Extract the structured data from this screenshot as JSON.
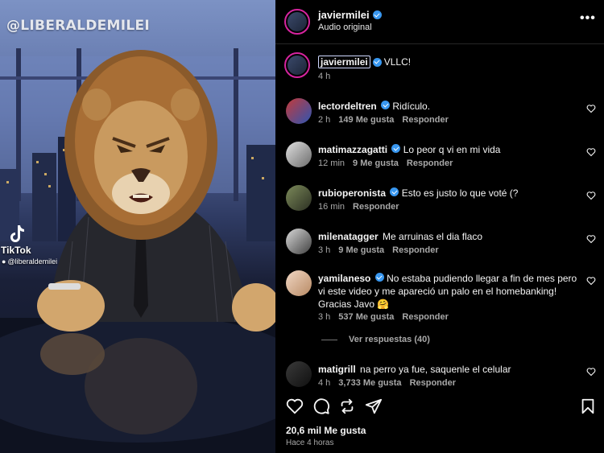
{
  "video": {
    "watermark": "@LIBERALDEMILEI",
    "tiktok_brand": "TikTok",
    "tiktok_user": "@liberaldemilei"
  },
  "header": {
    "username": "javiermilei",
    "audio": "Audio original",
    "more": "•••"
  },
  "caption": {
    "username": "javiermilei",
    "text": "VLLC!",
    "time": "4 h"
  },
  "comments": [
    {
      "username": "lectordeltren",
      "verified": true,
      "text": "Ridículo.",
      "time": "2 h",
      "likes": "149 Me gusta",
      "reply": "Responder"
    },
    {
      "username": "matimazzagatti",
      "verified": true,
      "text": "Lo peor q vi en mi vida",
      "time": "12 min",
      "likes": "9 Me gusta",
      "reply": "Responder"
    },
    {
      "username": "rubioperonista",
      "verified": true,
      "text": "Esto es justo lo que voté (?",
      "time": "16 min",
      "likes": "",
      "reply": "Responder"
    },
    {
      "username": "milenatagger",
      "verified": false,
      "text": "Me arruinas el dia flaco",
      "time": "3 h",
      "likes": "9 Me gusta",
      "reply": "Responder"
    },
    {
      "username": "yamilaneso",
      "verified": true,
      "text": "No estaba pudiendo llegar a fin de mes pero vi este video y me apareció un palo en el homebanking! Gracias Javo 🤗",
      "time": "3 h",
      "likes": "537 Me gusta",
      "reply": "Responder"
    },
    {
      "username": "matigrill",
      "verified": false,
      "text": "na perro ya fue, saquenle el celular",
      "time": "4 h",
      "likes": "3,733 Me gusta",
      "reply": "Responder"
    }
  ],
  "view_replies": "Ver respuestas (40)",
  "footer": {
    "likes": "20,6 mil Me gusta",
    "posted": "Hace 4 horas"
  },
  "icons": [
    "heart-icon",
    "comment-icon",
    "repost-icon",
    "share-icon",
    "save-icon",
    "more-icon",
    "verified-icon",
    "tiktok-icon"
  ],
  "colors": {
    "verified": "#3897f0",
    "background": "#000000",
    "secondary_text": "#a8a8a8",
    "ring": "#d6249f"
  }
}
